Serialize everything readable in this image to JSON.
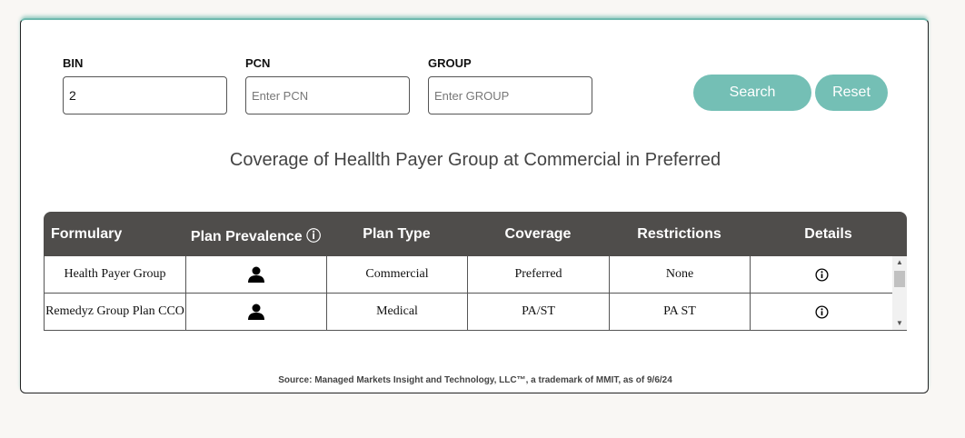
{
  "form": {
    "bin": {
      "label": "BIN",
      "value": "2",
      "placeholder": ""
    },
    "pcn": {
      "label": "PCN",
      "value": "",
      "placeholder": "Enter PCN"
    },
    "group": {
      "label": "GROUP",
      "value": "",
      "placeholder": "Enter GROUP"
    },
    "search_label": "Search",
    "reset_label": "Reset"
  },
  "title": "Coverage of Heallth Payer Group at Commercial in Preferred",
  "table": {
    "headers": [
      "Formulary",
      "Plan Prevalence ⓘ",
      "Plan Type",
      "Coverage",
      "Restrictions",
      "Details"
    ],
    "rows": [
      {
        "formulary": "Health Payer Group",
        "prevalence_icon": "person-icon",
        "plan_type": "Commercial",
        "coverage": "Preferred",
        "restrictions": "None",
        "details_icon": "info-icon"
      },
      {
        "formulary": "Remedyz Group Plan CCO",
        "prevalence_icon": "person-icon",
        "plan_type": "Medical",
        "coverage": "PA/ST",
        "restrictions": "PA ST",
        "details_icon": "info-icon"
      }
    ]
  },
  "source": "Source: Managed Markets Insight and Technology, LLC™, a trademark of MMIT, as of 9/6/24",
  "colors": {
    "accent": "#74bfb5",
    "header_bg": "#4f4d4b",
    "page_bg": "#f9f7f4"
  }
}
